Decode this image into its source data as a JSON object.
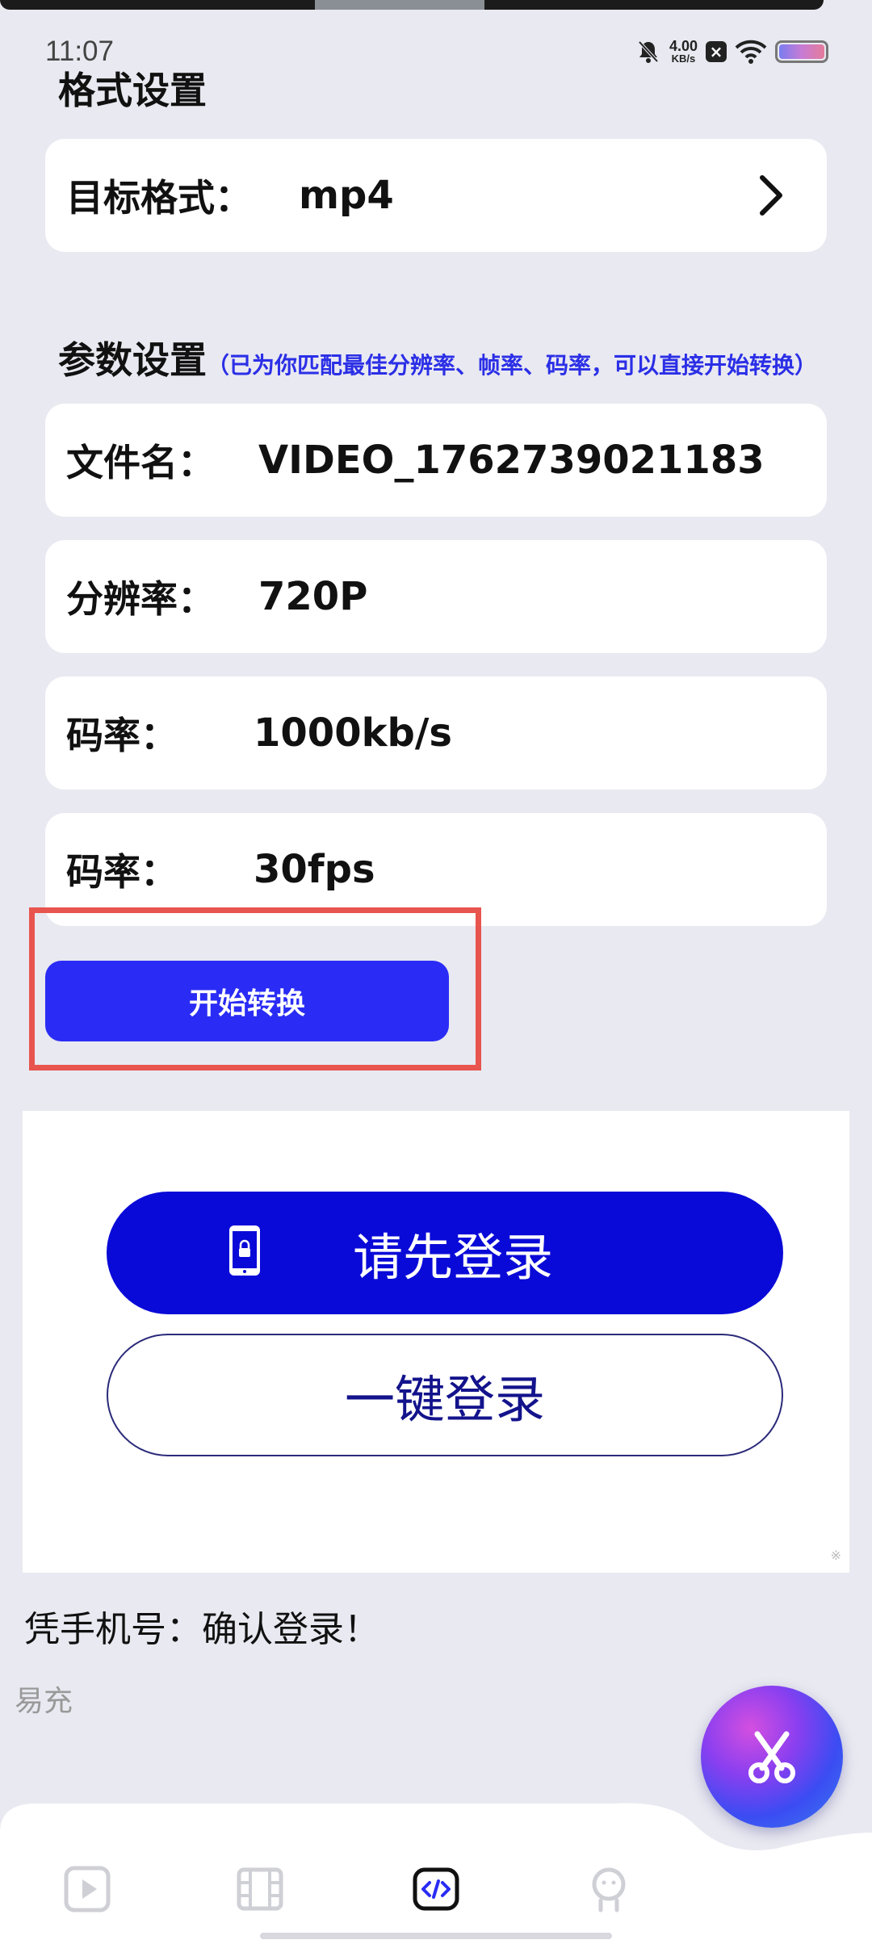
{
  "status_bar": {
    "time": "11:07",
    "net_speed": "4.00",
    "net_unit": "KB/s",
    "sim_icon": "sim-off-icon",
    "battery_icon": "battery-icon"
  },
  "format_settings": {
    "title": "格式设置",
    "target_label": "目标格式：",
    "target_value": "mp4"
  },
  "param_settings": {
    "title": "参数设置",
    "hint": "（已为你匹配最佳分辨率、帧率、码率，可以直接开始转换）",
    "rows": [
      {
        "label": "文件名：",
        "value": "VIDEO_1762739021183"
      },
      {
        "label": "分辨率：",
        "value": "720P"
      },
      {
        "label": "码率：",
        "value": "1000kb/s"
      },
      {
        "label": "码率：",
        "value": "30fps"
      }
    ]
  },
  "actions": {
    "start_label": "开始转换"
  },
  "login_ad": {
    "login_label": "请先登录",
    "onekey_label": "一键登录",
    "ad_mark": "※",
    "confirm_text": "凭手机号：确认登录！",
    "brand": "易充"
  },
  "colors": {
    "accent": "#2a2cf5",
    "login_blue": "#0a0ad8",
    "hint_blue": "#2b2fe6",
    "highlight_red": "#e8544e",
    "background": "#e9e9f1"
  },
  "bottom_nav": {
    "items": [
      "play-icon",
      "film-icon",
      "code-icon",
      "profile-icon"
    ],
    "active_index": 2
  }
}
